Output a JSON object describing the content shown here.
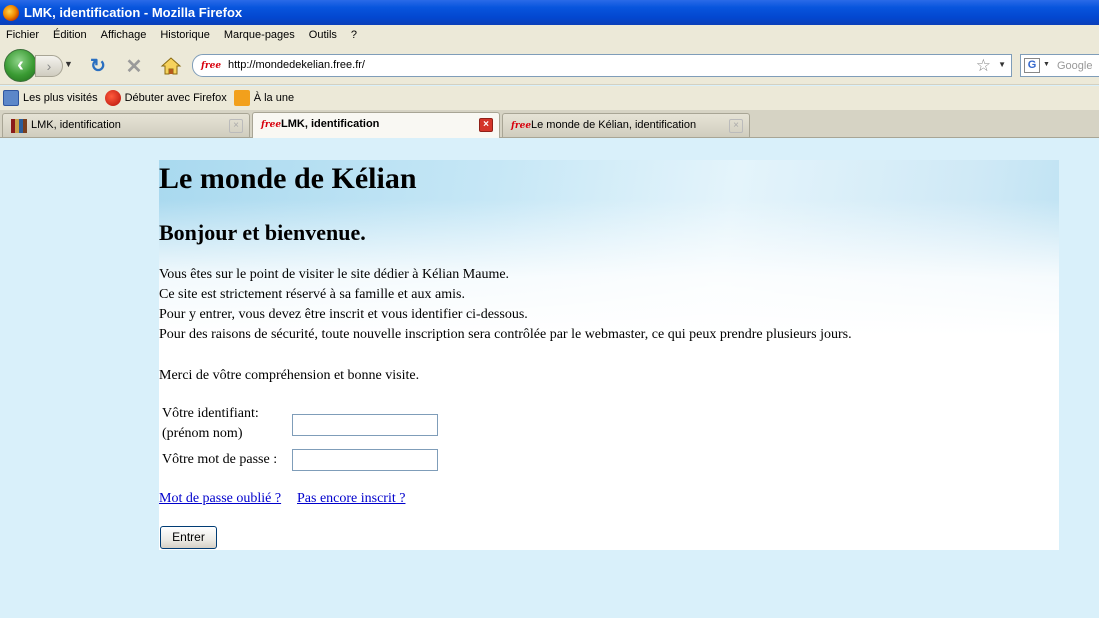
{
  "window": {
    "title": "LMK, identification - Mozilla Firefox"
  },
  "menu": [
    "Fichier",
    "Édition",
    "Affichage",
    "Historique",
    "Marque-pages",
    "Outils",
    "?"
  ],
  "nav": {
    "url": "http://mondedekelian.free.fr/",
    "favicon_text": "free",
    "search_placeholder": "Google",
    "search_engine_icon": "G"
  },
  "bookmarks": [
    {
      "label": "Les plus visités",
      "icon": "most-visited-icon"
    },
    {
      "label": "Débuter avec Firefox",
      "icon": "firefox-icon"
    },
    {
      "label": "À la une",
      "icon": "rss-icon"
    }
  ],
  "tabs": [
    {
      "label": "LMK, identification",
      "active": false,
      "icon": "books-icon"
    },
    {
      "label": "LMK, identification",
      "active": true,
      "icon": "free-icon"
    },
    {
      "label": "Le monde de Kélian, identification",
      "active": false,
      "icon": "free-icon"
    }
  ],
  "page": {
    "title": "Le monde de Kélian",
    "welcome": "Bonjour et bienvenue.",
    "lines": [
      "Vous êtes sur le point de visiter le site dédier à Kélian Maume.",
      "Ce site est strictement réservé à sa famille et aux amis.",
      "Pour y entrer, vous devez être inscrit et vous identifier ci-dessous.",
      "Pour des raisons de sécurité, toute nouvelle inscription sera contrôlée par le webmaster, ce qui peux prendre plusieurs jours."
    ],
    "thanks": "Merci de vôtre compréhension et bonne visite.",
    "form": {
      "id_label_1": "Vôtre identifiant:",
      "id_label_2": "(prénom nom)",
      "id_value": "",
      "pw_label": "Vôtre mot de passe :",
      "pw_value": ""
    },
    "link_forgot": "Mot de passe oublié ?",
    "link_register": "Pas encore inscrit ?",
    "submit_label": "Entrer"
  }
}
